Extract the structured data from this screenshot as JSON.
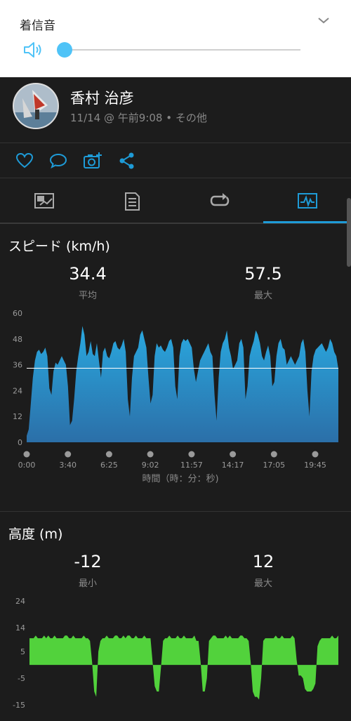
{
  "volume": {
    "title": "着信音",
    "level": 0,
    "speaker_icon": "speaker-icon",
    "collapse_icon": "chevron-down-icon"
  },
  "profile": {
    "name": "香村 治彦",
    "meta": "11/14 @ 午前9:08 • その他"
  },
  "actions": [
    "like-icon",
    "comment-icon",
    "add-photo-icon",
    "share-icon"
  ],
  "tabs": [
    "overview-tab",
    "details-tab",
    "laps-tab",
    "charts-tab"
  ],
  "active_tab": 3,
  "colors": {
    "accent": "#1e9bd7",
    "speed_fill_top": "#2aa8df",
    "speed_fill_bottom": "#2b6fa8",
    "elevation_fill": "#52d23c",
    "background": "#1c1c1c"
  },
  "speed": {
    "title": "スピード (km/h)",
    "avg_value": "34.4",
    "avg_label": "平均",
    "max_value": "57.5",
    "max_label": "最大",
    "x_title": "時間（時：分：秒)"
  },
  "elevation": {
    "title": "高度 (m)",
    "min_value": "-12",
    "min_label": "最小",
    "max_value": "12",
    "max_label": "最大"
  },
  "chart_data": [
    {
      "type": "area",
      "title": "スピード (km/h)",
      "xlabel": "時間（時：分：秒)",
      "ylabel": "",
      "ylim": [
        0,
        60
      ],
      "yticks": [
        "60",
        "48",
        "36",
        "24",
        "12",
        "0"
      ],
      "xticks": [
        "0:00",
        "3:40",
        "6:25",
        "9:02",
        "11:57",
        "14:17",
        "17:05",
        "19:45"
      ],
      "average_line": 34.4,
      "grid": false,
      "values": [
        3,
        6,
        18,
        30,
        38,
        42,
        43,
        41,
        42,
        44,
        40,
        25,
        22,
        33,
        37,
        36,
        38,
        40,
        38,
        36,
        26,
        8,
        10,
        20,
        33,
        40,
        46,
        54,
        50,
        40,
        42,
        47,
        41,
        40,
        46,
        38,
        30,
        42,
        44,
        40,
        39,
        42,
        46,
        47,
        44,
        43,
        45,
        48,
        42,
        20,
        12,
        30,
        40,
        42,
        44,
        50,
        52,
        48,
        44,
        30,
        18,
        22,
        40,
        46,
        44,
        45,
        43,
        42,
        44,
        47,
        48,
        44,
        26,
        20,
        40,
        46,
        48,
        47,
        48,
        46,
        44,
        34,
        28,
        33,
        38,
        40,
        42,
        44,
        46,
        42,
        40,
        22,
        10,
        30,
        42,
        46,
        48,
        52,
        44,
        40,
        34,
        36,
        38,
        46,
        48,
        44,
        20,
        26,
        40,
        44,
        47,
        52,
        50,
        46,
        40,
        38,
        42,
        45,
        40,
        26,
        28,
        40,
        46,
        48,
        44,
        43,
        36,
        38,
        40,
        38,
        36,
        38,
        40,
        46,
        48,
        42,
        24,
        12,
        33,
        40,
        43,
        44,
        45,
        46,
        44,
        42,
        44,
        48,
        46,
        42,
        40,
        34
      ]
    },
    {
      "type": "area",
      "title": "高度 (m)",
      "ylim": [
        -15,
        24
      ],
      "yticks": [
        "24",
        "14",
        "5",
        "-5",
        "-15"
      ],
      "grid": false,
      "values": [
        10,
        10,
        10,
        11,
        10,
        10,
        10,
        11,
        10,
        11,
        10,
        10,
        11,
        10,
        10,
        10,
        10,
        11,
        11,
        10,
        10,
        11,
        10,
        10,
        10,
        10,
        11,
        10,
        10,
        9,
        1,
        -10,
        -12,
        5,
        9,
        10,
        10,
        11,
        10,
        10,
        10,
        11,
        11,
        10,
        10,
        11,
        10,
        11,
        11,
        10,
        10,
        11,
        10,
        10,
        10,
        11,
        10,
        10,
        10,
        1,
        -8,
        -10,
        -10,
        -1,
        9,
        10,
        10,
        11,
        10,
        10,
        10,
        11,
        10,
        10,
        11,
        10,
        10,
        10,
        10,
        11,
        9,
        9,
        1,
        -10,
        -10,
        -5,
        9,
        10,
        11,
        11,
        10,
        10,
        10,
        10,
        11,
        10,
        11,
        10,
        10,
        10,
        10,
        11,
        11,
        10,
        10,
        9,
        1,
        -10,
        -12,
        -12,
        -13,
        -5,
        9,
        10,
        10,
        10,
        10,
        10,
        11,
        10,
        10,
        11,
        10,
        10,
        10,
        10,
        11,
        10,
        2,
        -4,
        -4,
        -5,
        -9,
        -10,
        -10,
        -10,
        -9,
        -7,
        7,
        9,
        10,
        10,
        10,
        10,
        10,
        11,
        10,
        10,
        11
      ]
    }
  ]
}
